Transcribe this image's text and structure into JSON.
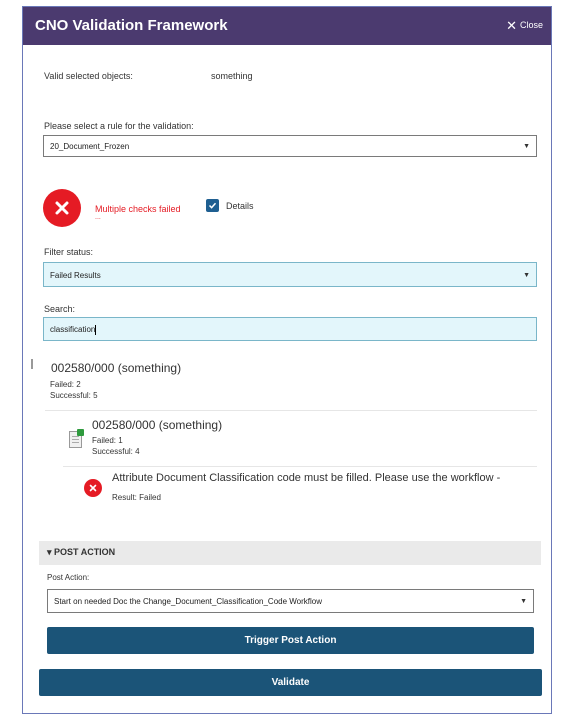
{
  "window": {
    "title": "CNO Validation Framework",
    "close_label": "Close"
  },
  "valid_objects": {
    "label": "Valid selected objects:",
    "value": "something"
  },
  "rule": {
    "label": "Please select a rule for the validation:",
    "selected": "20_Document_Frozen"
  },
  "status": {
    "message": "Multiple checks failed",
    "ellipsis": "...",
    "details_label": "Details",
    "details_checked": true
  },
  "filter": {
    "label": "Filter status:",
    "selected": "Failed Results"
  },
  "search": {
    "label": "Search:",
    "value": "classification"
  },
  "results": {
    "parent": {
      "title": "002580/000 (something)",
      "failed": "Failed:  2",
      "successful": "Successful:  5"
    },
    "child": {
      "title": "002580/000 (something)",
      "failed": "Failed:  1",
      "successful": "Successful:  4"
    },
    "message": {
      "text": "Attribute Document Classification code must be filled. Please use the workflow -",
      "result": "Result:  Failed"
    }
  },
  "post_action": {
    "section_title": "▾ POST ACTION",
    "label": "Post Action:",
    "selected": "Start on needed Doc the Change_Document_Classification_Code Workflow",
    "trigger_button": "Trigger Post Action"
  },
  "validate_button": "Validate",
  "colors": {
    "titlebar": "#4b3a6f",
    "error": "#e51b24",
    "primary_button": "#1b5478",
    "input_bg": "#e3f6fb"
  }
}
